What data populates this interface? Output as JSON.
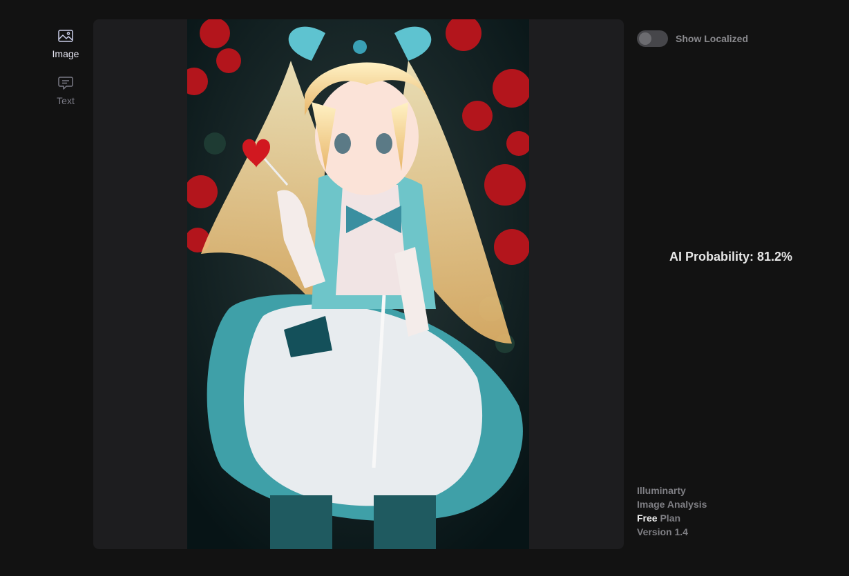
{
  "nav": {
    "items": [
      {
        "label": "Image",
        "icon": "image-icon",
        "active": true
      },
      {
        "label": "Text",
        "icon": "chat-text-icon",
        "active": false
      }
    ]
  },
  "viewer": {
    "image_description_icon": "anime-artwork-image"
  },
  "controls": {
    "show_localized_label": "Show Localized",
    "show_localized_on": false
  },
  "result": {
    "ai_probability_text": "AI Probability: 81.2%",
    "ai_probability_value": 81.2
  },
  "footer": {
    "brand": "Illuminarty",
    "product": "Image Analysis",
    "plan_name": "Free",
    "plan_suffix": "Plan",
    "version": "Version 1.4"
  },
  "colors": {
    "background": "#121212",
    "panel": "#1d1d1f",
    "toggle_track": "#46464a",
    "muted_text": "#7f7f84"
  }
}
